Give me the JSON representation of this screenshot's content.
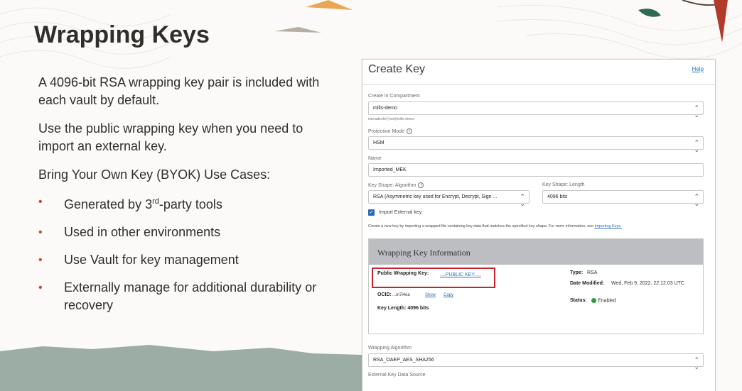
{
  "slide": {
    "title": "Wrapping Keys",
    "para1": "A 4096-bit RSA wrapping key pair is included with each vault by default.",
    "para2": "Use the public wrapping key when you need to import an external key.",
    "para3": "Bring Your Own Key (BYOK) Use Cases:",
    "bullets": [
      {
        "pre": "Generated by 3",
        "sup": "rd",
        "post": "-party tools"
      },
      {
        "pre": "Used in other environments",
        "sup": "",
        "post": ""
      },
      {
        "pre": "Use Vault for key management",
        "sup": "",
        "post": ""
      },
      {
        "pre": "Externally manage for additional durability or recovery",
        "sup": "",
        "post": ""
      }
    ],
    "bullet_glyph": "•",
    "accent_color": "#c74634"
  },
  "dialog": {
    "title": "Create Key",
    "help": "Help",
    "compartment": {
      "label": "Create in Compartment",
      "value": "mills-demo",
      "path": "intoradeshit (root)/mills-demo"
    },
    "protection_mode": {
      "label": "Protection Mode",
      "value": "HSM"
    },
    "name": {
      "label": "Name",
      "value": "Imported_MEK"
    },
    "key_shape_algorithm": {
      "label": "Key Shape: Algorithm",
      "value": "RSA (Asymmetric key used for Encrypt, Decrypt, Sign ..."
    },
    "key_shape_length": {
      "label": "Key Shape: Length",
      "value": "4096 bits"
    },
    "import_external": {
      "label": "Import External key",
      "checked": true
    },
    "description": {
      "text": "Create a new key by importing a wrapped file containing key data that matches the specified key shape. For more information, see ",
      "link": "Importing Keys."
    },
    "wrapping_info": {
      "title": "Wrapping Key Information",
      "public_key_label": "Public Wrapping Key:",
      "public_key_value": "....PUBLIC KEY.....",
      "ocid_label": "OCID:",
      "ocid_value": "...m7i4ea",
      "show": "Show",
      "copy": "Copy",
      "key_length": "Key Length: 4096 bits",
      "type_label": "Type:",
      "type_value": "RSA",
      "date_label": "Date Modified:",
      "date_value": "Wed, Feb 9, 2022, 22:12:03 UTC",
      "status_label": "Status:",
      "status_value": "Enabled"
    },
    "wrapping_algorithm": {
      "label": "Wrapping Algorithm",
      "value": "RSA_OAEP_AES_SHA256"
    },
    "external_source": {
      "label": "External Key Data Source"
    }
  },
  "icons": {
    "select_chevron": "⌃⌄",
    "check": "✓",
    "info": "i"
  }
}
